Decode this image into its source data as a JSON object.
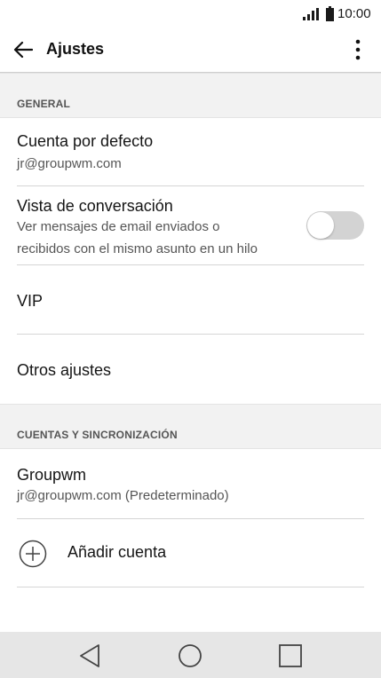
{
  "status_bar": {
    "time": "10:00"
  },
  "app_bar": {
    "title": "Ajustes"
  },
  "sections": {
    "general": {
      "header": "GENERAL",
      "default_account": {
        "title": "Cuenta por defecto",
        "subtitle": "jr@groupwm.com"
      },
      "conversation_view": {
        "title": "Vista de conversación",
        "subtitle_line1": "Ver mensajes de email enviados o",
        "subtitle_line2": "recibidos con el mismo asunto en un hilo",
        "enabled": false
      },
      "vip": {
        "title": "VIP"
      },
      "other_settings": {
        "title": "Otros ajustes"
      }
    },
    "accounts": {
      "header": "CUENTAS Y SINCRONIZACIÓN",
      "account": {
        "title": "Groupwm",
        "subtitle": "jr@groupwm.com (Predeterminado)"
      },
      "add_account": {
        "title": "Añadir cuenta"
      }
    }
  },
  "icons": {
    "back": "arrow-left-icon",
    "more": "more-vertical-icon",
    "add": "plus-circle-icon",
    "signal": "signal-icon",
    "battery": "battery-icon",
    "nav_back": "triangle-back-icon",
    "nav_home": "circle-home-icon",
    "nav_recents": "square-recents-icon"
  },
  "colors": {
    "toggle_off": "#d3d3d3",
    "nav_bar": "#e6e6e6",
    "section_bg": "#f2f2f2"
  }
}
